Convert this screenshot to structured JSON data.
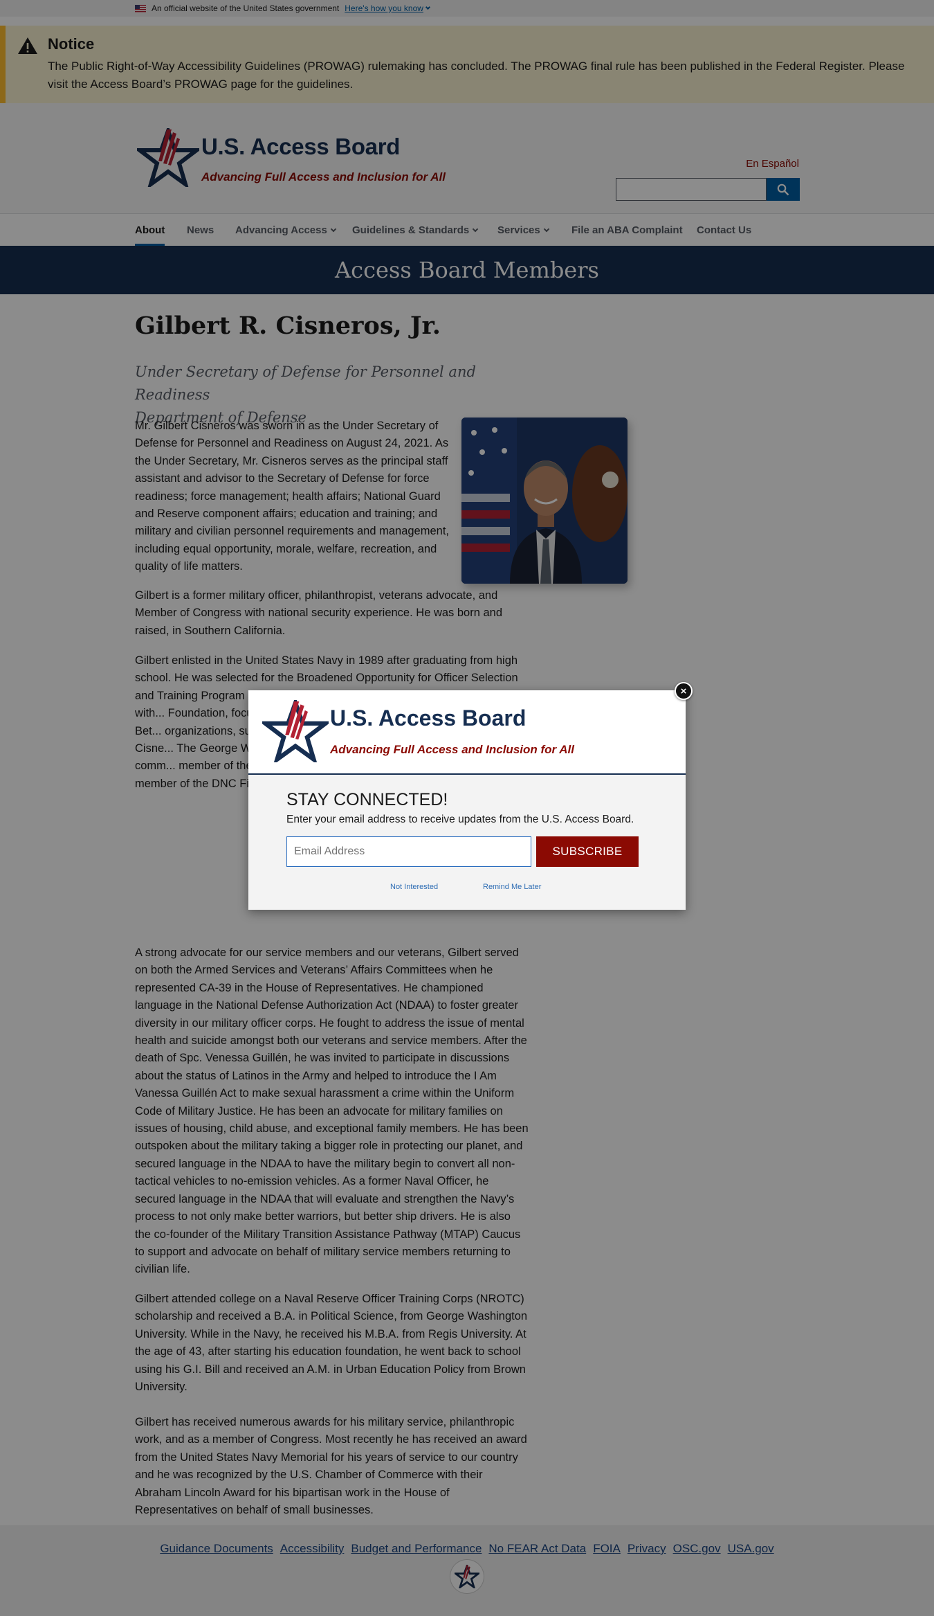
{
  "gov_banner": {
    "text": "An official website of the United States government",
    "link": "Here's how you know"
  },
  "notice": {
    "title": "Notice",
    "text": "The Public Right-of-Way Accessibility Guidelines (PROWAG) rulemaking has concluded. The PROWAG final rule has been published in the Federal Register. Please visit the Access Board’s PROWAG page for the guidelines."
  },
  "header": {
    "title": "U.S. Access Board",
    "tagline": "Advancing Full Access and Inclusion for All",
    "espanol": "En Español",
    "search_placeholder": ""
  },
  "nav": {
    "items": [
      {
        "label": "About",
        "active": true,
        "dropdown": false
      },
      {
        "label": "News",
        "active": false,
        "dropdown": false
      },
      {
        "label": "Advancing Access",
        "active": false,
        "dropdown": true
      },
      {
        "label": "Guidelines & Standards",
        "active": false,
        "dropdown": true
      },
      {
        "label": "Services",
        "active": false,
        "dropdown": true
      },
      {
        "label": "File an ABA Complaint",
        "active": false,
        "dropdown": false
      },
      {
        "label": "Contact Us",
        "active": false,
        "dropdown": false
      }
    ]
  },
  "page": {
    "hero_title": "Access Board Members",
    "member_name": "Gilbert R. Cisneros, Jr.",
    "member_title_line1": "Under Secretary of Defense for Personnel and Readiness",
    "member_title_line2": "Department of Defense",
    "paragraphs": [
      "Mr. Gilbert Cisneros was sworn in as the Under Secretary of Defense for Personnel and Readiness on August 24, 2021. As the Under Secretary, Mr. Cisneros serves as the principal staff assistant and advisor to the Secretary of Defense for force readiness; force management; health affairs; National Guard and Reserve component affairs; education and training; and military and civilian personnel requirements and management, including equal opportunity, morale, welfare, recreation, and quality of life matters.",
      "Gilbert is a former military officer, philanthropist, veterans advocate, and Member of Congress with national security experience. He was born and raised, in Southern California.",
      "Gilbert enlisted in the United States Navy in 1989 after graduating from high school. He was selected for the Broadened Opportunity for Officer Selection and Training Program a... Navy in 1994. After 10 ye... Frito-Lay. In 2010, with... Foundation, focused o... scholarships and colleg... initiatives, such as Bet... organizations, such as l... college campuses, and... also founded The Cisne... The George Washingto... Latino students, but is... affect the Latino comm... member of the President's Advisory Council for the Arts and a member of the DNC Finance Committee.",
      "A strong advocate for our service members and our veterans, Gilbert served on both the Armed Services and Veterans’ Affairs Committees when he represented CA-39 in the House of Representatives. He championed language in the National Defense Authorization Act (NDAA) to foster greater diversity in our military officer corps. He fought to address the issue of mental health and suicide amongst both our veterans and service members. After the death of Spc. Venessa Guillén, he was invited to participate in discussions about the status of Latinos in the Army and helped to introduce the I Am Vanessa Guillén Act to make sexual harassment a crime within the Uniform Code of Military Justice. He has been an advocate for military families on issues of housing, child abuse, and exceptional family members. He has been outspoken about the military taking a bigger role in protecting our planet, and secured language in the NDAA to have the military begin to convert all non-tactical vehicles to no-emission vehicles. As a former Naval Officer, he secured language in the NDAA that will evaluate and strengthen the Navy’s process to not only make better warriors, but better ship drivers. He is also the co-founder of the Military Transition Assistance Pathway (MTAP) Caucus to support and advocate on behalf of military service members returning to civilian life.",
      "Gilbert attended college on a Naval Reserve Officer Training Corps (NROTC) scholarship and received a B.A. in Political Science, from George Washington University. While in the Navy, he received his M.B.A. from Regis University. At the age of 43, after starting his education foundation, he went back to school using his G.I. Bill and received an A.M. in Urban Education Policy from Brown University.",
      "Gilbert has received numerous awards for his military service, philanthropic work, and as a member of Congress. Most recently he has received an award from the United States Navy Memorial for his years of service to our country and he was recognized by the U.S. Chamber of Commerce with their Abraham Lincoln Award for his bipartisan work in the House of Representatives on behalf of small businesses."
    ]
  },
  "footer": {
    "links": [
      "Guidance Documents",
      "Accessibility",
      "Budget and Performance",
      "No FEAR Act Data",
      "FOIA",
      "Privacy",
      "OSC.gov",
      "USA.gov"
    ]
  },
  "modal": {
    "title": "U.S. Access Board",
    "tagline": "Advancing Full Access and Inclusion for All",
    "heading": "STAY CONNECTED!",
    "description": "Enter your email address to receive updates from the U.S. Access Board.",
    "email_placeholder": "Email Address",
    "subscribe_label": "SUBSCRIBE",
    "not_interested": "Not Interested",
    "remind_later": "Remind Me Later"
  },
  "colors": {
    "navy": "#162e51",
    "brand_red": "#8b0a03",
    "link_blue": "#005ea2",
    "notice_bg": "#faf3d1",
    "notice_border": "#ffbe2e"
  }
}
